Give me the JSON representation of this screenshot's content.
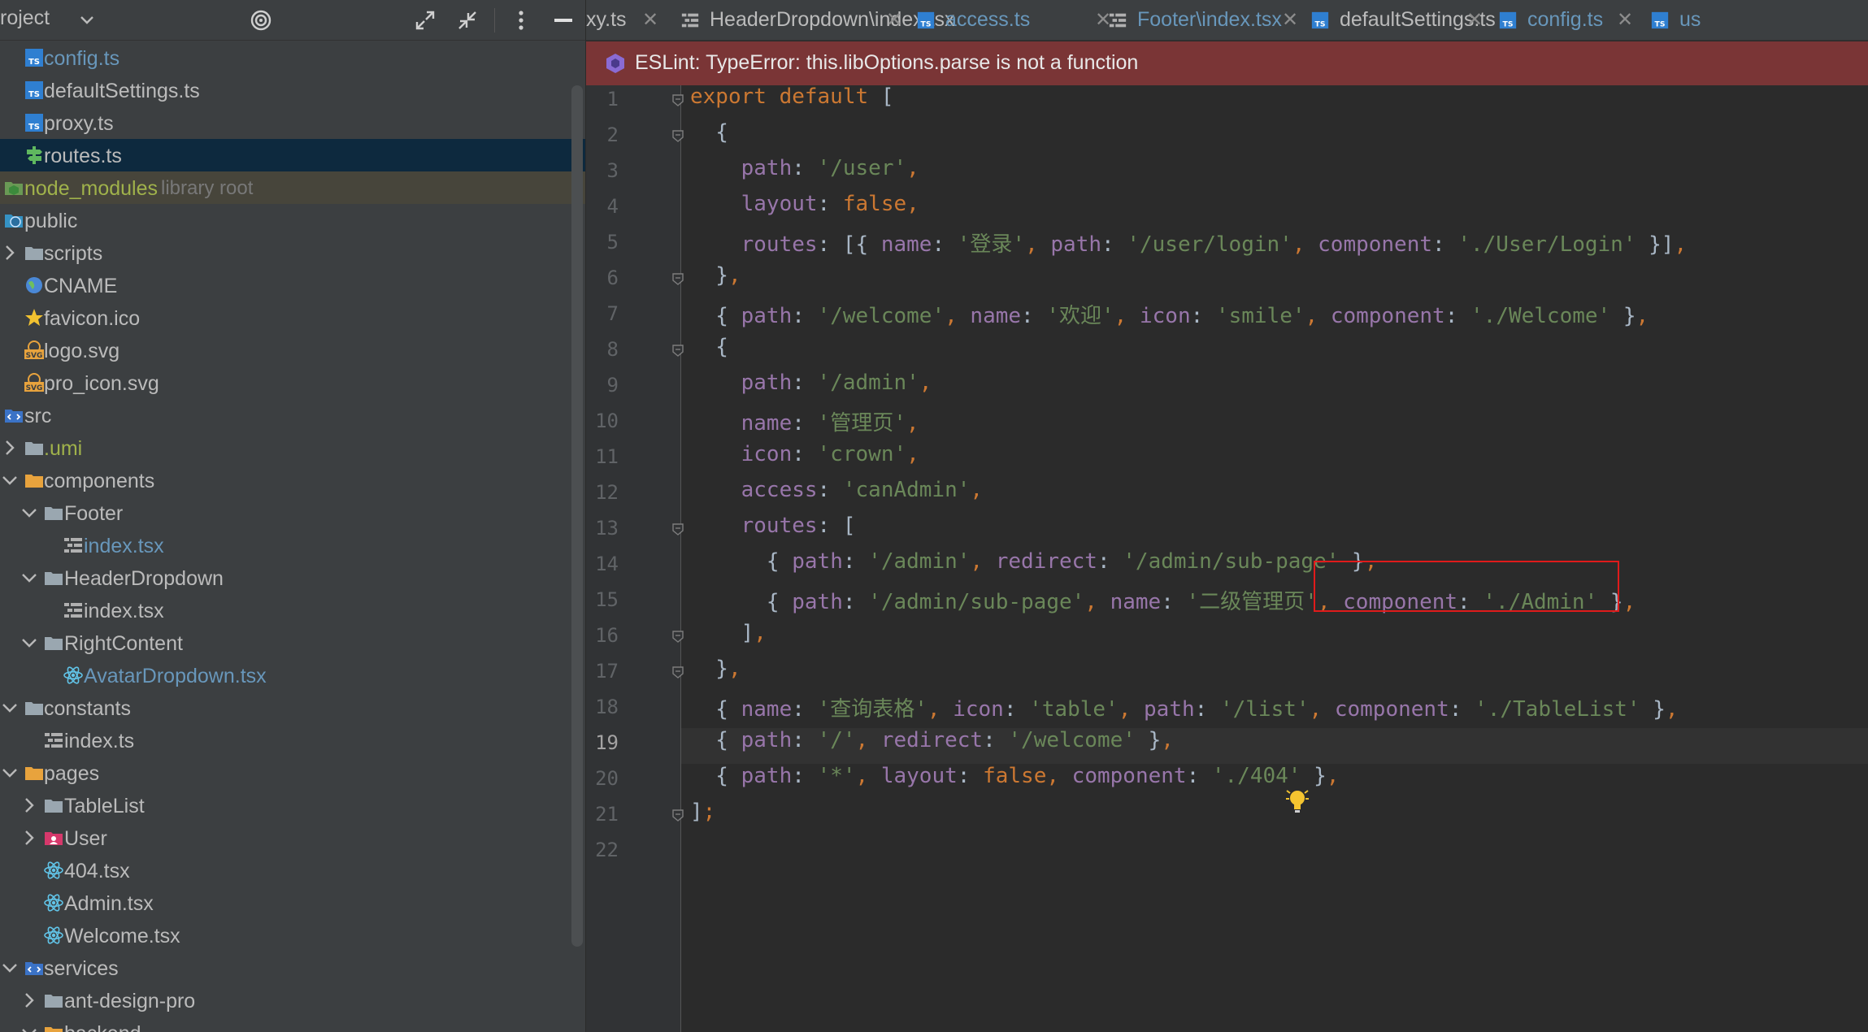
{
  "project_panel": {
    "title": "roject",
    "header_icons": [
      "target-icon",
      "expand-icon",
      "collapse-icon",
      "more-icon",
      "minimize-icon"
    ],
    "tree": [
      {
        "label": "config.ts",
        "icon": "ts-file-icon",
        "color": "blue"
      },
      {
        "label": "defaultSettings.ts",
        "icon": "ts-file-icon"
      },
      {
        "label": "proxy.ts",
        "icon": "ts-file-icon"
      },
      {
        "label": "routes.ts",
        "icon": "routes-file-icon",
        "selected": true
      },
      {
        "label": "node_modules",
        "suffix": "library root",
        "icon": "library-folder-icon",
        "color": "lime",
        "library": true
      },
      {
        "label": "public",
        "icon": "web-folder-icon"
      },
      {
        "label": "scripts",
        "icon": "folder-icon",
        "expand": "collapsed"
      },
      {
        "label": "CNAME",
        "icon": "globe-icon"
      },
      {
        "label": "favicon.ico",
        "icon": "star-icon"
      },
      {
        "label": "logo.svg",
        "icon": "svg-file-icon"
      },
      {
        "label": "pro_icon.svg",
        "icon": "svg-file-icon"
      },
      {
        "label": "src",
        "icon": "source-folder-icon"
      },
      {
        "label": ".umi",
        "icon": "folder-icon",
        "expand": "collapsed",
        "color": "lime"
      },
      {
        "label": "components",
        "icon": "folder-icon",
        "expand": "expanded"
      },
      {
        "label": "Footer",
        "icon": "folder-icon",
        "expand": "expanded"
      },
      {
        "label": "index.tsx",
        "icon": "tsx-file-icon",
        "color": "blue"
      },
      {
        "label": "HeaderDropdown",
        "icon": "folder-icon",
        "expand": "expanded"
      },
      {
        "label": "index.tsx",
        "icon": "tsx-file-icon"
      },
      {
        "label": "RightContent",
        "icon": "folder-icon",
        "expand": "expanded"
      },
      {
        "label": "AvatarDropdown.tsx",
        "icon": "react-icon",
        "color": "blue"
      },
      {
        "label": "constants",
        "icon": "folder-icon",
        "expand": "expanded"
      },
      {
        "label": "index.ts",
        "icon": "tsx-file-icon"
      },
      {
        "label": "pages",
        "icon": "folder-icon",
        "expand": "expanded"
      },
      {
        "label": "TableList",
        "icon": "folder-icon",
        "expand": "collapsed"
      },
      {
        "label": "User",
        "icon": "user-folder-icon",
        "expand": "collapsed"
      },
      {
        "label": "404.tsx",
        "icon": "react-icon"
      },
      {
        "label": "Admin.tsx",
        "icon": "react-icon"
      },
      {
        "label": "Welcome.tsx",
        "icon": "react-icon"
      },
      {
        "label": "services",
        "icon": "folder-icon",
        "expand": "expanded"
      },
      {
        "label": "ant-design-pro",
        "icon": "folder-icon",
        "expand": "collapsed"
      },
      {
        "label": "backend",
        "icon": "folder-icon",
        "expand": "expanded"
      }
    ]
  },
  "tabs": [
    {
      "label": "xy.ts",
      "icon": "",
      "color": "#bbbbbb"
    },
    {
      "label": "HeaderDropdown\\index.tsx",
      "icon": "tsx-file-icon",
      "color": "#bbbbbb"
    },
    {
      "label": "access.ts",
      "icon": "ts-file-icon",
      "color": "#6897bb"
    },
    {
      "label": "Footer\\index.tsx",
      "icon": "tsx-file-icon",
      "color": "#6897bb"
    },
    {
      "label": "defaultSettings.ts",
      "icon": "ts-file-icon",
      "color": "#bbbbbb"
    },
    {
      "label": "config.ts",
      "icon": "ts-file-icon",
      "color": "#6897bb"
    },
    {
      "label": "us",
      "icon": "ts-file-icon",
      "color": "#6897bb"
    }
  ],
  "close_glyph": "✕",
  "banner": {
    "text": "ESLint: TypeError: this.libOptions.parse is not a function"
  },
  "editor": {
    "current_line": 19,
    "lines": [
      [
        [
          "kw",
          "export default "
        ],
        [
          "p",
          "["
        ]
      ],
      [
        [
          "p",
          "  {"
        ]
      ],
      [
        [
          "prop",
          "    path"
        ],
        [
          "p",
          ": "
        ],
        [
          "str",
          "'/user'"
        ],
        [
          "punc",
          ","
        ]
      ],
      [
        [
          "prop",
          "    layout"
        ],
        [
          "p",
          ": "
        ],
        [
          "kw",
          "false"
        ],
        [
          "punc",
          ","
        ]
      ],
      [
        [
          "prop",
          "    routes"
        ],
        [
          "p",
          ": [{ "
        ],
        [
          "prop",
          "name"
        ],
        [
          "p",
          ": "
        ],
        [
          "str",
          "'登录'"
        ],
        [
          "punc",
          ", "
        ],
        [
          "prop",
          "path"
        ],
        [
          "p",
          ": "
        ],
        [
          "str",
          "'/user/login'"
        ],
        [
          "punc",
          ", "
        ],
        [
          "prop",
          "component"
        ],
        [
          "p",
          ": "
        ],
        [
          "str",
          "'./User/Login'"
        ],
        [
          "p",
          " }]"
        ],
        [
          "punc",
          ","
        ]
      ],
      [
        [
          "p",
          "  }"
        ],
        [
          "punc",
          ","
        ]
      ],
      [
        [
          "p",
          "  { "
        ],
        [
          "prop",
          "path"
        ],
        [
          "p",
          ": "
        ],
        [
          "str",
          "'/welcome'"
        ],
        [
          "punc",
          ", "
        ],
        [
          "prop",
          "name"
        ],
        [
          "p",
          ": "
        ],
        [
          "str",
          "'欢迎'"
        ],
        [
          "punc",
          ", "
        ],
        [
          "prop",
          "icon"
        ],
        [
          "p",
          ": "
        ],
        [
          "str",
          "'smile'"
        ],
        [
          "punc",
          ", "
        ],
        [
          "prop",
          "component"
        ],
        [
          "p",
          ": "
        ],
        [
          "str",
          "'./Welcome'"
        ],
        [
          "p",
          " }"
        ],
        [
          "punc",
          ","
        ]
      ],
      [
        [
          "p",
          "  {"
        ]
      ],
      [
        [
          "prop",
          "    path"
        ],
        [
          "p",
          ": "
        ],
        [
          "str",
          "'/admin'"
        ],
        [
          "punc",
          ","
        ]
      ],
      [
        [
          "prop",
          "    name"
        ],
        [
          "p",
          ": "
        ],
        [
          "str",
          "'管理页'"
        ],
        [
          "punc",
          ","
        ]
      ],
      [
        [
          "prop",
          "    icon"
        ],
        [
          "p",
          ": "
        ],
        [
          "str",
          "'crown'"
        ],
        [
          "punc",
          ","
        ]
      ],
      [
        [
          "prop",
          "    access"
        ],
        [
          "p",
          ": "
        ],
        [
          "str",
          "'canAdmin'"
        ],
        [
          "punc",
          ","
        ]
      ],
      [
        [
          "prop",
          "    routes"
        ],
        [
          "p",
          ": ["
        ]
      ],
      [
        [
          "p",
          "      { "
        ],
        [
          "prop",
          "path"
        ],
        [
          "p",
          ": "
        ],
        [
          "str",
          "'/admin'"
        ],
        [
          "punc",
          ", "
        ],
        [
          "prop",
          "redirect"
        ],
        [
          "p",
          ": "
        ],
        [
          "str",
          "'/admin/sub-page'"
        ],
        [
          "p",
          " }"
        ],
        [
          "punc",
          ","
        ]
      ],
      [
        [
          "p",
          "      { "
        ],
        [
          "prop",
          "path"
        ],
        [
          "p",
          ": "
        ],
        [
          "str",
          "'/admin/sub-page'"
        ],
        [
          "punc",
          ", "
        ],
        [
          "prop",
          "name"
        ],
        [
          "p",
          ": "
        ],
        [
          "str",
          "'二级管理页'"
        ],
        [
          "punc",
          ", "
        ],
        [
          "prop",
          "component"
        ],
        [
          "p",
          ": "
        ],
        [
          "str",
          "'./Admin'"
        ],
        [
          "p",
          " }"
        ],
        [
          "punc",
          ","
        ]
      ],
      [
        [
          "p",
          "    ]"
        ],
        [
          "punc",
          ","
        ]
      ],
      [
        [
          "p",
          "  }"
        ],
        [
          "punc",
          ","
        ]
      ],
      [
        [
          "p",
          "  { "
        ],
        [
          "prop",
          "name"
        ],
        [
          "p",
          ": "
        ],
        [
          "str",
          "'查询表格'"
        ],
        [
          "punc",
          ", "
        ],
        [
          "prop",
          "icon"
        ],
        [
          "p",
          ": "
        ],
        [
          "str",
          "'table'"
        ],
        [
          "punc",
          ", "
        ],
        [
          "prop",
          "path"
        ],
        [
          "p",
          ": "
        ],
        [
          "str",
          "'/list'"
        ],
        [
          "punc",
          ", "
        ],
        [
          "prop",
          "component"
        ],
        [
          "p",
          ": "
        ],
        [
          "str",
          "'./TableList'"
        ],
        [
          "p",
          " }"
        ],
        [
          "punc",
          ","
        ]
      ],
      [
        [
          "p",
          "  { "
        ],
        [
          "prop",
          "path"
        ],
        [
          "p",
          ": "
        ],
        [
          "str",
          "'/'"
        ],
        [
          "punc",
          ", "
        ],
        [
          "prop",
          "redirect"
        ],
        [
          "p",
          ": "
        ],
        [
          "str",
          "'/welcome'"
        ],
        [
          "p",
          " }"
        ],
        [
          "punc",
          ","
        ]
      ],
      [
        [
          "p",
          "  { "
        ],
        [
          "prop",
          "path"
        ],
        [
          "p",
          ": "
        ],
        [
          "str",
          "'*'"
        ],
        [
          "punc",
          ", "
        ],
        [
          "prop",
          "layout"
        ],
        [
          "p",
          ": "
        ],
        [
          "kw",
          "false"
        ],
        [
          "punc",
          ", "
        ],
        [
          "prop",
          "component"
        ],
        [
          "p",
          ": "
        ],
        [
          "str",
          "'./404'"
        ],
        [
          "p",
          " }"
        ],
        [
          "punc",
          ","
        ]
      ],
      [
        [
          "p",
          "]"
        ],
        [
          "punc",
          ";"
        ]
      ],
      []
    ],
    "fold_lines": [
      1,
      2,
      6,
      8,
      13,
      16,
      17,
      21
    ]
  }
}
